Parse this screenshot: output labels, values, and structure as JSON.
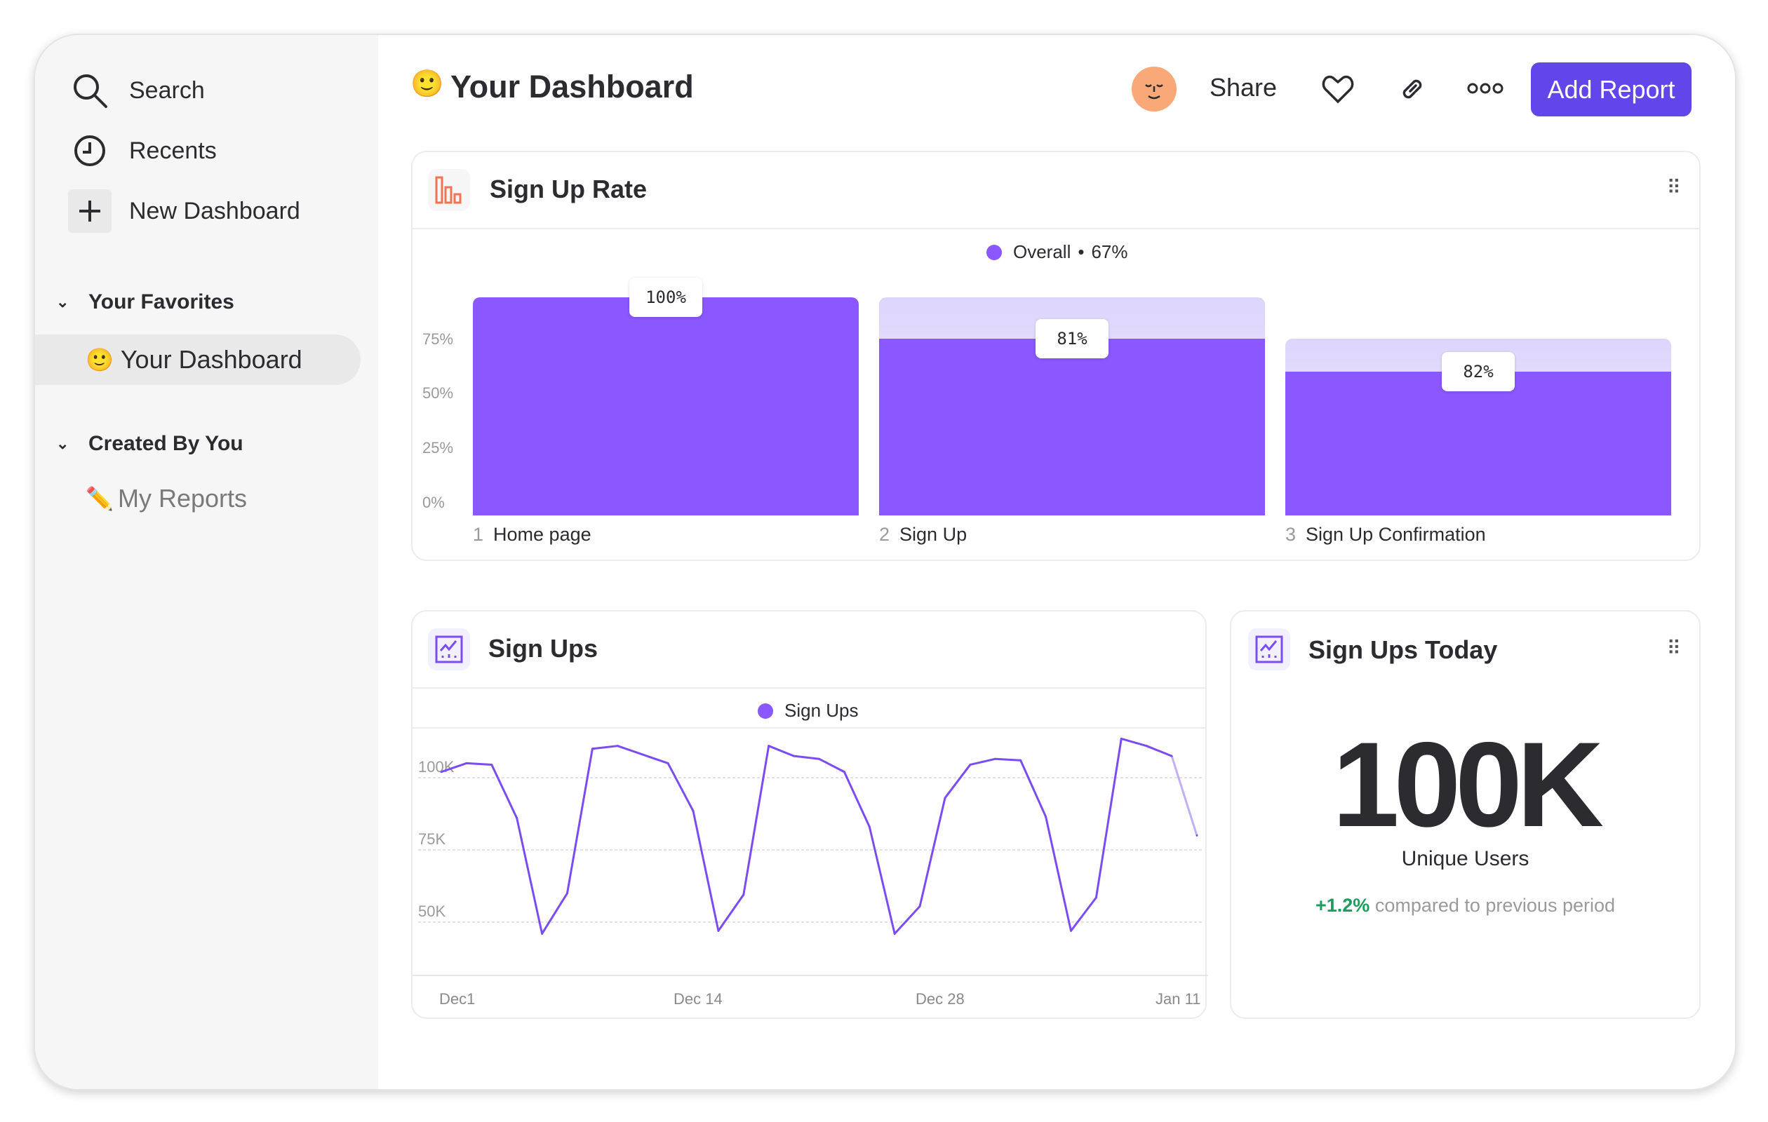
{
  "sidebar": {
    "items": [
      {
        "label": "Search",
        "icon": "search-icon"
      },
      {
        "label": "Recents",
        "icon": "clock-icon"
      },
      {
        "label": "New Dashboard",
        "icon": "plus-icon"
      }
    ],
    "favorites": {
      "label": "Your Favorites",
      "items": [
        {
          "emoji": "🙂",
          "label": "Your Dashboard"
        }
      ]
    },
    "created": {
      "label": "Created By You",
      "items": [
        {
          "emoji": "✏️",
          "label": "My Reports"
        }
      ]
    }
  },
  "header": {
    "emoji": "🙂",
    "title": "Your Dashboard",
    "share": "Share",
    "add_report": "Add Report",
    "accent": "#6246ea"
  },
  "signup_rate": {
    "title": "Sign Up Rate",
    "legend": {
      "name": "Overall",
      "value": "67%"
    },
    "chart_data": {
      "type": "bar",
      "subtype": "funnel",
      "categories": [
        "Home page",
        "Sign Up",
        "Sign Up Confirmation"
      ],
      "step_numbers": [
        "1",
        "2",
        "3"
      ],
      "values": [
        100,
        81,
        66
      ],
      "labels": [
        "100%",
        "81%",
        "82%"
      ],
      "yticks": [
        "75%",
        "50%",
        "25%",
        "0%"
      ],
      "ylim": [
        0,
        100
      ],
      "color": "#8b57ff",
      "ghost_color": "#ddd5fc"
    }
  },
  "signups": {
    "title": "Sign Ups",
    "chart_data": {
      "type": "line",
      "series": [
        {
          "name": "Sign Ups",
          "values": [
            102000,
            105000,
            104500,
            86000,
            46000,
            60000,
            110000,
            111000,
            108000,
            105000,
            88500,
            47000,
            59500,
            111000,
            107500,
            106500,
            102000,
            83000,
            46000,
            55500,
            93000,
            104500,
            106500,
            106000,
            86500,
            47000,
            58500,
            113500,
            111000,
            107500,
            80000
          ]
        }
      ],
      "xticks": [
        "Dec1",
        "Dec 14",
        "Dec 28",
        "Jan 11"
      ],
      "yticks": [
        {
          "label": "100K",
          "value": 100000
        },
        {
          "label": "75K",
          "value": 75000
        },
        {
          "label": "50K",
          "value": 50000
        }
      ],
      "color": "#7b4df0",
      "grid": true
    }
  },
  "today": {
    "title": "Sign Ups Today",
    "value": "100K",
    "metric": "Unique Users",
    "change": "+1.2%",
    "change_text": "compared to previous period",
    "change_color": "#1a9e5c"
  }
}
